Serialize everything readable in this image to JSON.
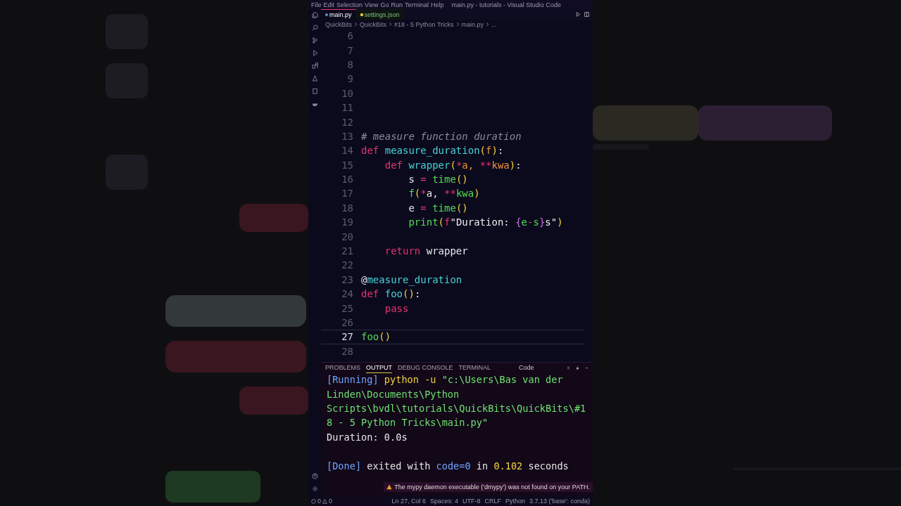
{
  "window": {
    "title": "main.py - tutorials - Visual Studio Code"
  },
  "menu": [
    "File",
    "Edit",
    "Selection",
    "View",
    "Go",
    "Run",
    "Terminal",
    "Help"
  ],
  "tabs": [
    {
      "label": "main.py",
      "selected": true,
      "kind": "python"
    },
    {
      "label": "settings.json",
      "selected": false,
      "kind": "json"
    }
  ],
  "breadcrumb": [
    "QuickBits",
    "QuickBits",
    "#18 - 5 Python Tricks",
    "main.py",
    "..."
  ],
  "editor": {
    "lines": [
      {
        "number": "6",
        "current": false
      },
      {
        "number": "7",
        "current": false
      },
      {
        "number": "8",
        "current": false
      },
      {
        "number": "9",
        "current": false
      },
      {
        "number": "10",
        "current": false
      },
      {
        "number": "11",
        "current": false
      },
      {
        "number": "12",
        "current": false
      },
      {
        "number": "13",
        "current": false,
        "tokens": [
          {
            "text": "# measure function duration",
            "kind": "comment"
          }
        ]
      },
      {
        "number": "14",
        "current": false,
        "tokens": [
          {
            "text": "def ",
            "kind": "keyword"
          },
          {
            "text": "measure_duration",
            "kind": "function"
          },
          {
            "text": "(",
            "kind": "paren"
          },
          {
            "text": "f",
            "kind": "param"
          },
          {
            "text": ")",
            "kind": "paren"
          },
          {
            "text": ":",
            "kind": "plain"
          }
        ]
      },
      {
        "number": "15",
        "current": false,
        "tokens": [
          {
            "text": "    def ",
            "kind": "keyword"
          },
          {
            "text": "wrapper",
            "kind": "function"
          },
          {
            "text": "(",
            "kind": "paren"
          },
          {
            "text": "*",
            "kind": "operator"
          },
          {
            "text": "a, ",
            "kind": "param"
          },
          {
            "text": "**",
            "kind": "operator"
          },
          {
            "text": "kwa",
            "kind": "param"
          },
          {
            "text": ")",
            "kind": "paren"
          },
          {
            "text": ":",
            "kind": "plain"
          }
        ]
      },
      {
        "number": "16",
        "current": false,
        "tokens": [
          {
            "text": "        s ",
            "kind": "plain"
          },
          {
            "text": "=",
            "kind": "operator"
          },
          {
            "text": " time",
            "kind": "call"
          },
          {
            "text": "()",
            "kind": "paren"
          }
        ]
      },
      {
        "number": "17",
        "current": false,
        "tokens": [
          {
            "text": "        f",
            "kind": "call"
          },
          {
            "text": "(",
            "kind": "paren"
          },
          {
            "text": "*",
            "kind": "operator"
          },
          {
            "text": "a, ",
            "kind": "plain"
          },
          {
            "text": "**",
            "kind": "operator"
          },
          {
            "text": "kwa",
            "kind": "call"
          },
          {
            "text": ")",
            "kind": "paren"
          }
        ]
      },
      {
        "number": "18",
        "current": false,
        "tokens": [
          {
            "text": "        e ",
            "kind": "plain"
          },
          {
            "text": "=",
            "kind": "operator"
          },
          {
            "text": " time",
            "kind": "call"
          },
          {
            "text": "()",
            "kind": "paren"
          }
        ]
      },
      {
        "number": "19",
        "current": false,
        "tokens": [
          {
            "text": "        print",
            "kind": "call"
          },
          {
            "text": "(",
            "kind": "paren"
          },
          {
            "text": "f",
            "kind": "keyword"
          },
          {
            "text": "\"Duration: ",
            "kind": "string"
          },
          {
            "text": "{",
            "kind": "brace"
          },
          {
            "text": "e",
            "kind": "call"
          },
          {
            "text": "-",
            "kind": "operator"
          },
          {
            "text": "s",
            "kind": "call"
          },
          {
            "text": "}",
            "kind": "brace"
          },
          {
            "text": "s\"",
            "kind": "string"
          },
          {
            "text": ")",
            "kind": "paren"
          }
        ]
      },
      {
        "number": "20",
        "current": false
      },
      {
        "number": "21",
        "current": false,
        "tokens": [
          {
            "text": "    return ",
            "kind": "keyword"
          },
          {
            "text": "wrapper",
            "kind": "plain"
          }
        ]
      },
      {
        "number": "22",
        "current": false
      },
      {
        "number": "23",
        "current": false,
        "tokens": [
          {
            "text": "@",
            "kind": "plain"
          },
          {
            "text": "measure_duration",
            "kind": "function"
          }
        ]
      },
      {
        "number": "24",
        "current": false,
        "tokens": [
          {
            "text": "def ",
            "kind": "keyword"
          },
          {
            "text": "foo",
            "kind": "function"
          },
          {
            "text": "()",
            "kind": "paren"
          },
          {
            "text": ":",
            "kind": "plain"
          }
        ]
      },
      {
        "number": "25",
        "current": false,
        "tokens": [
          {
            "text": "    pass",
            "kind": "keyword"
          }
        ]
      },
      {
        "number": "26",
        "current": false
      },
      {
        "number": "27",
        "current": true,
        "tokens": [
          {
            "text": "foo",
            "kind": "call"
          },
          {
            "text": "()",
            "kind": "paren"
          }
        ]
      },
      {
        "number": "28",
        "current": false
      }
    ]
  },
  "panel": {
    "tabs": [
      {
        "label": "PROBLEMS",
        "selected": false
      },
      {
        "label": "OUTPUT",
        "selected": true
      },
      {
        "label": "DEBUG CONSOLE",
        "selected": false
      },
      {
        "label": "TERMINAL",
        "selected": false
      }
    ],
    "channel": "Code",
    "output": [
      [
        [
          {
            "text": "[Running]",
            "kind": "tag"
          },
          {
            "text": " python -u ",
            "kind": "command"
          },
          {
            "text": "\"c:\\Users\\Bas van der",
            "kind": "path"
          }
        ],
        [
          {
            "text": "Linden\\Documents\\Python",
            "kind": "path"
          }
        ],
        [
          {
            "text": "Scripts\\bvdl\\tutorials\\QuickBits\\QuickBits\\#1",
            "kind": "path"
          }
        ],
        [
          {
            "text": "8 - 5 Python Tricks\\main.py\"",
            "kind": "path"
          }
        ],
        [
          {
            "text": "Duration: 0.0s",
            "kind": "plain"
          }
        ]
      ],
      [
        [
          {
            "text": "[Done]",
            "kind": "tag"
          },
          {
            "text": " exited with ",
            "kind": "plain"
          },
          {
            "text": "code=0",
            "kind": "tag"
          },
          {
            "text": " in ",
            "kind": "plain"
          },
          {
            "text": "0.102",
            "kind": "command"
          },
          {
            "text": " seconds",
            "kind": "plain"
          }
        ]
      ]
    ]
  },
  "notification": "The mypy daemon executable ('dmypy') was not found on your PATH.",
  "status_bar": {
    "errors": "0",
    "warnings": "0",
    "items": [
      "Ln 27, Col 6",
      "Spaces: 4",
      "UTF-8",
      "CRLF",
      "Python",
      "3.7.13 ('base': conda)"
    ]
  }
}
